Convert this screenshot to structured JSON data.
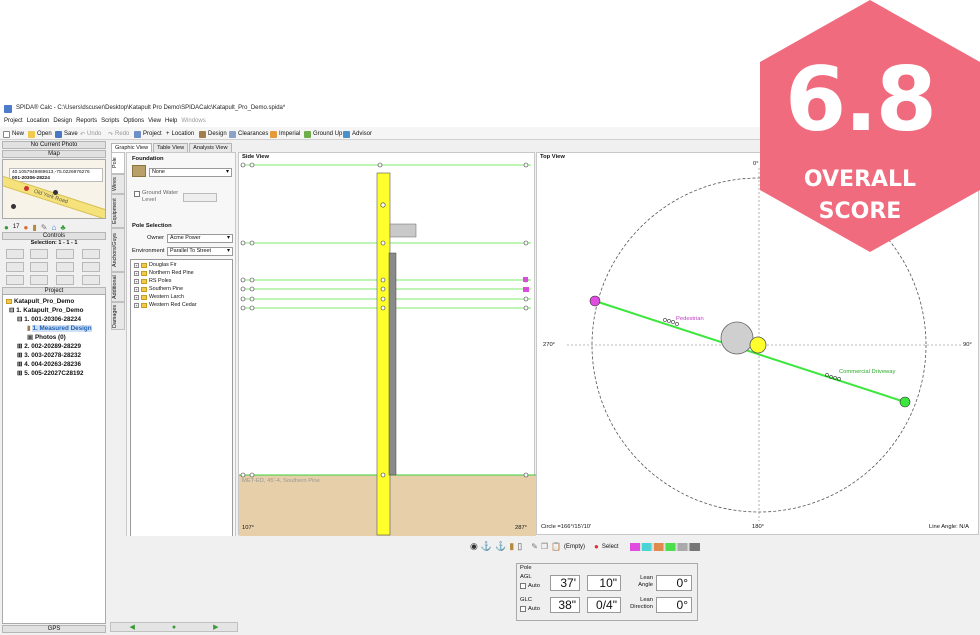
{
  "window": {
    "title": "SPIDA® Calc - C:\\Users\\dscuser\\Desktop\\Katapult Pro Demo\\SPIDACalc\\Katapult_Pro_Demo.spida*"
  },
  "menu": [
    "Project",
    "Location",
    "Design",
    "Reports",
    "Scripts",
    "Options",
    "View",
    "Help",
    "Windows"
  ],
  "toolbar": {
    "new": "New",
    "open": "Open",
    "save": "Save",
    "undo": "Undo",
    "redo": "Redo",
    "project": "Project",
    "location": "Location",
    "design": "Design",
    "clearances": "Clearances",
    "imperial": "Imperial",
    "ground_up": "Ground Up",
    "advisor": "Advisor"
  },
  "left": {
    "photo_header": "No Current Photo",
    "map_header": "Map",
    "map_coords": "40.1057949889613,-75.0226976276",
    "map_id": "001-20306-28224",
    "road_label": "Old York Road",
    "map_count": "17",
    "controls_header": "Controls",
    "selection": "Selection: 1 - 1 - 1",
    "project_header": "Project",
    "gps_label": "GPS",
    "tree": {
      "root": "Katapult_Pro_Demo",
      "lead": "1. Katapult_Pro_Demo",
      "loc1": "1. 001-20306-28224",
      "design": "1. Measured Design",
      "photos": "Photos (0)",
      "loc2": "2. 002-20289-28229",
      "loc3": "3. 003-20278-28232",
      "loc4": "4. 004-20263-28236",
      "loc5": "5. 005-22027C28192"
    }
  },
  "tabs": [
    "Graphic View",
    "Table View",
    "Analysis View"
  ],
  "vertical_tabs": [
    "Pole",
    "Wires",
    "Equipment",
    "Anchors/Guys",
    "Additional",
    "Damages"
  ],
  "props": {
    "foundation_label": "Foundation",
    "foundation_value": "None",
    "ground_water_label": "Ground Water Level",
    "pole_selection_label": "Pole Selection",
    "owner_label": "Owner",
    "owner_value": "Acme Power",
    "environment_label": "Environment",
    "environment_value": "Parallel To Street",
    "species": [
      "Douglas Fir",
      "Northern Red Pine",
      "RS Poles",
      "Southern Pine",
      "Western Larch",
      "Western Red Cedar"
    ]
  },
  "side_view": {
    "header": "Side View",
    "ground_label": "MET-ED, 45'-4, Southern Pine",
    "left_angle": "107°",
    "right_angle": "287°"
  },
  "top_view": {
    "header": "Top View",
    "deg_270": "270°",
    "deg_90": "90°",
    "deg_0": "0°",
    "deg_180": "180°",
    "span1": "Pedestrian",
    "span2": "Commercial Driveway",
    "circle_readout": "Circle =166°/15'/10'",
    "line_angle": "Line Angle: N/A"
  },
  "bottom_tools": {
    "empty": "(Empty)",
    "select": "Select"
  },
  "pole_panel": {
    "title": "Pole",
    "agl_label": "AGL",
    "agl_ft": "37'",
    "agl_in": "10\"",
    "glc_label": "GLC",
    "glc_ft": "38\"",
    "glc_in": "0/4\"",
    "auto_label": "Auto",
    "lean_angle_label": "Lean Angle",
    "lean_angle": "0°",
    "lean_dir_label": "Lean Direction",
    "lean_dir": "0°"
  },
  "score": {
    "value": "6.8",
    "line1": "OVERALL",
    "line2": "SCORE",
    "color": "#f06b7d"
  }
}
